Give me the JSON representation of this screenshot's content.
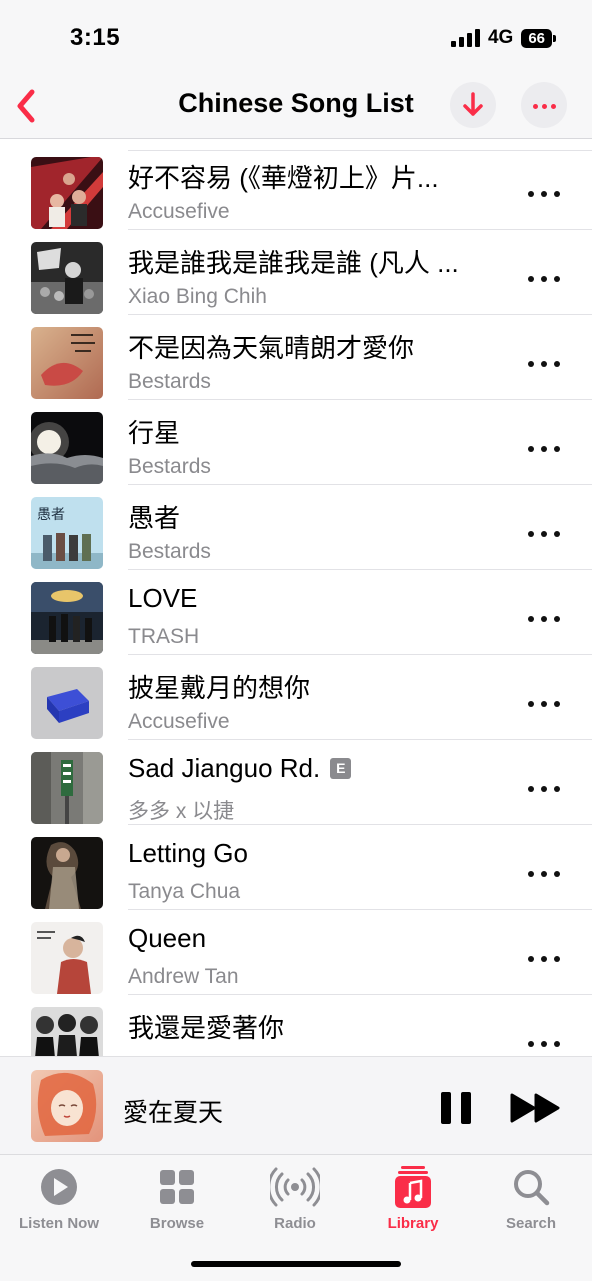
{
  "status_bar": {
    "time": "3:15",
    "network": "4G",
    "battery": "66"
  },
  "nav": {
    "title": "Chinese Song List",
    "icons": [
      "chevron-left-icon",
      "download-arrow-icon",
      "ellipsis-icon"
    ],
    "accent": "#fa2d48"
  },
  "songs": [
    {
      "title": "好不容易 (《華燈初上》片...",
      "artist": "Accusefive",
      "explicit": false
    },
    {
      "title": "我是誰我是誰我是誰 (凡人 ...",
      "artist": "Xiao Bing Chih",
      "explicit": false
    },
    {
      "title": "不是因為天氣晴朗才愛你",
      "artist": "Bestards",
      "explicit": false
    },
    {
      "title": "行星",
      "artist": "Bestards",
      "explicit": false
    },
    {
      "title": "愚者",
      "artist": "Bestards",
      "explicit": false
    },
    {
      "title": "LOVE",
      "artist": "TRASH",
      "explicit": false
    },
    {
      "title": "披星戴月的想你",
      "artist": "Accusefive",
      "explicit": false
    },
    {
      "title": "Sad Jianguo Rd.",
      "artist": "多多 x 以捷",
      "explicit": true,
      "explicit_label": "E"
    },
    {
      "title": "Letting Go",
      "artist": "Tanya Chua",
      "explicit": false
    },
    {
      "title": "Queen",
      "artist": "Andrew Tan",
      "explicit": false
    },
    {
      "title": "我還是愛著你",
      "artist": "",
      "explicit": false
    }
  ],
  "mini_player": {
    "title": "愛在夏天",
    "icons": [
      "pause-icon",
      "fast-forward-icon"
    ]
  },
  "tabs": [
    {
      "label": "Listen Now",
      "icon": "play-circle-icon",
      "active": false
    },
    {
      "label": "Browse",
      "icon": "grid-icon",
      "active": false
    },
    {
      "label": "Radio",
      "icon": "broadcast-icon",
      "active": false
    },
    {
      "label": "Library",
      "icon": "music-note-icon",
      "active": true
    },
    {
      "label": "Search",
      "icon": "magnifier-icon",
      "active": false
    }
  ]
}
